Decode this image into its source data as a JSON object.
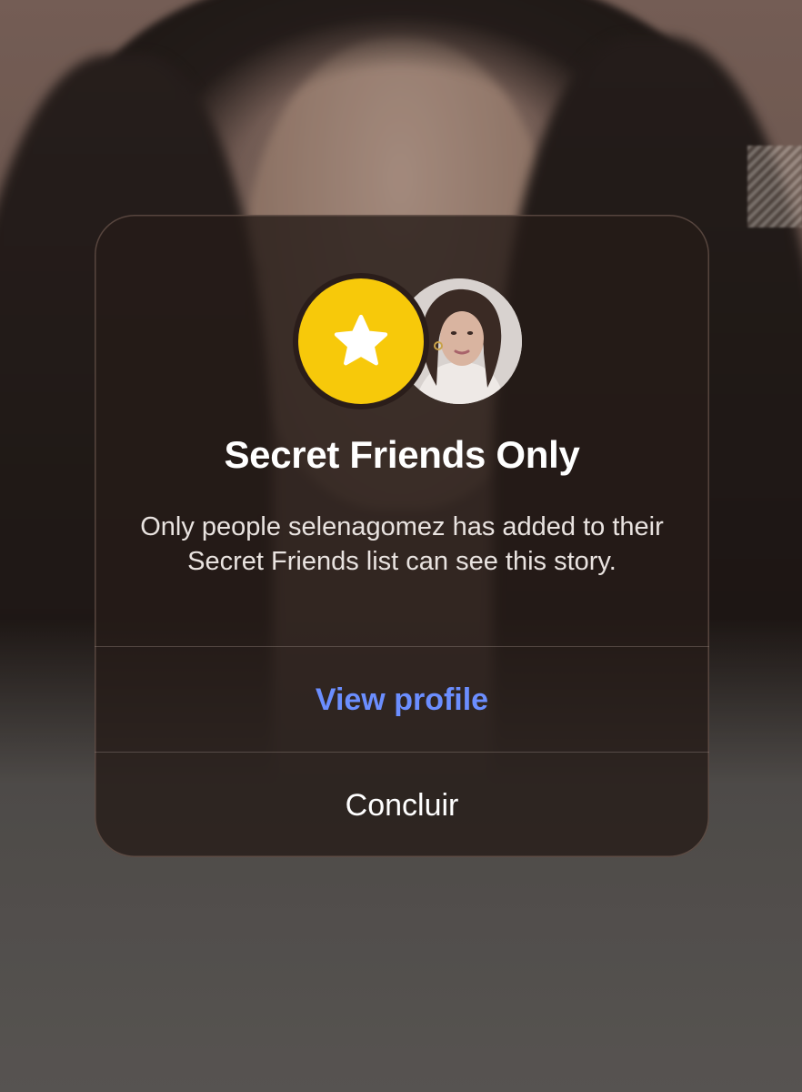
{
  "dialog": {
    "title": "Secret Friends Only",
    "message": "Only people selenagomez has added to their Secret Friends list can see this story.",
    "badge_icon": "star-icon",
    "badge_color": "#F7C90A",
    "avatar_alt": "selenagomez profile photo"
  },
  "actions": {
    "view_profile_label": "View profile",
    "view_profile_color": "#6B8EFF",
    "done_label": "Concluir"
  }
}
